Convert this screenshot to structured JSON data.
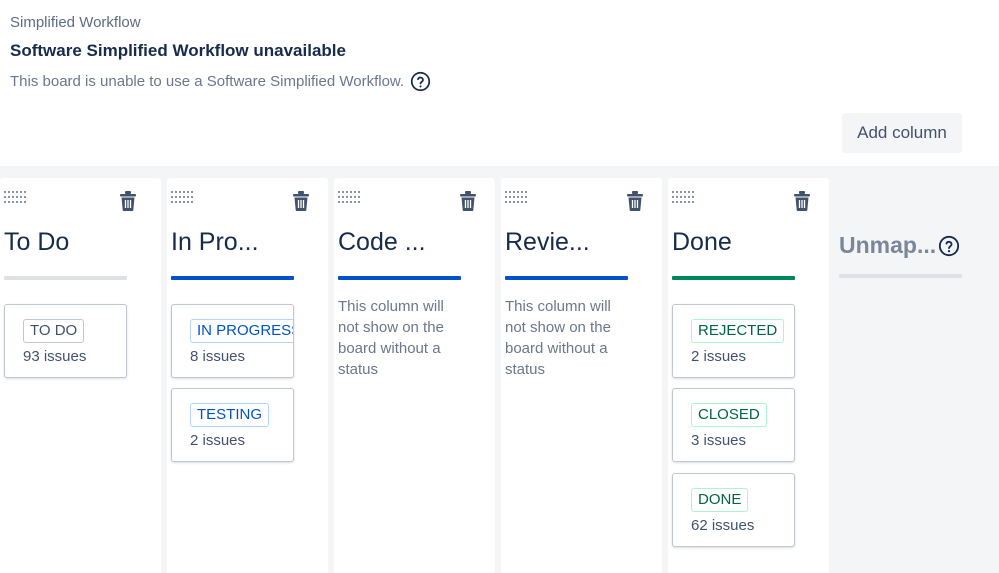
{
  "header": {
    "section_label": "Simplified Workflow",
    "title": "Software Simplified Workflow unavailable",
    "description": "This board is unable to use a Software Simplified Workflow."
  },
  "toolbar": {
    "add_column_label": "Add column"
  },
  "colors": {
    "todo_bar": "#dfe1e6",
    "in_progress_bar": "#0052cc",
    "done_bar": "#00875a",
    "todo_lozenge": "#42526e",
    "in_progress_lozenge": "#0052cc",
    "done_lozenge": "#006644"
  },
  "columns": [
    {
      "title": "To Do",
      "statuses": [
        {
          "label": "TO DO",
          "count": "93 issues"
        }
      ]
    },
    {
      "title": "In Pro...",
      "statuses": [
        {
          "label": "IN PROGRESS",
          "count": "8 issues"
        },
        {
          "label": "TESTING",
          "count": "2 issues"
        }
      ]
    },
    {
      "title": "Code ...",
      "empty_note": "This column will not show on the board without a status"
    },
    {
      "title": "Revie...",
      "empty_note": "This column will not show on the board without a status"
    },
    {
      "title": "Done",
      "statuses": [
        {
          "label": "REJECTED",
          "count": "2 issues"
        },
        {
          "label": "CLOSED",
          "count": "3 issues"
        },
        {
          "label": "DONE",
          "count": "62 issues"
        }
      ]
    }
  ],
  "unmapped": {
    "title": "Unmap..."
  },
  "icons": {
    "help": "help-circle-icon",
    "drag": "drag-handle-icon",
    "trash": "trash-icon"
  }
}
